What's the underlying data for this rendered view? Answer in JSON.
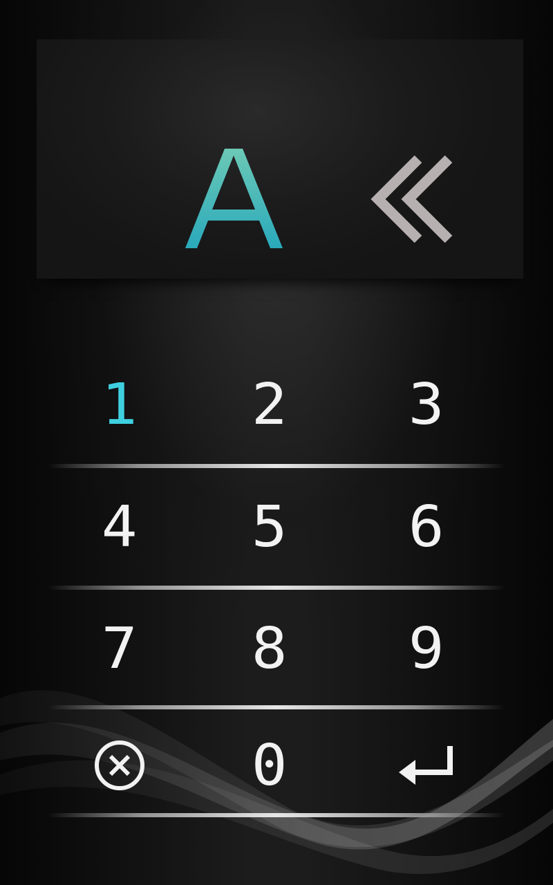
{
  "display": {
    "letter": "A",
    "letter_color": "#3fb3b8",
    "back_icon": "double-chevron-left-icon",
    "back_icon_color": "#b7b0b0"
  },
  "keypad": {
    "rows": [
      [
        {
          "label": "1",
          "active": true
        },
        {
          "label": "2"
        },
        {
          "label": "3"
        }
      ],
      [
        {
          "label": "4"
        },
        {
          "label": "5"
        },
        {
          "label": "6"
        }
      ],
      [
        {
          "label": "7"
        },
        {
          "label": "8"
        },
        {
          "label": "9"
        }
      ],
      [
        {
          "icon": "clear-circle-x-icon"
        },
        {
          "label": "0"
        },
        {
          "icon": "enter-return-icon"
        }
      ]
    ],
    "active_color": "#3fd0e0",
    "key_color": "#f2f2f2"
  }
}
